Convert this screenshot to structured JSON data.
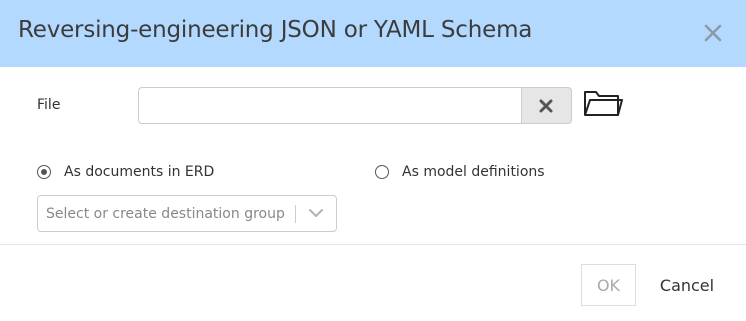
{
  "dialog": {
    "title": "Reversing-engineering JSON or YAML Schema",
    "close_icon": "close-icon"
  },
  "file": {
    "label": "File",
    "value": "",
    "clear_icon": "clear-x-icon",
    "browse_icon": "folder-icon"
  },
  "import_mode": {
    "options": [
      {
        "label": "As documents in ERD",
        "selected": true
      },
      {
        "label": "As model definitions",
        "selected": false
      }
    ]
  },
  "destination_group": {
    "placeholder": "Select or create destination group",
    "value": "",
    "arrow_icon": "chevron-down-icon"
  },
  "footer": {
    "ok_label": "OK",
    "ok_enabled": false,
    "cancel_label": "Cancel"
  },
  "colors": {
    "header_bg": "#b3d9ff",
    "disabled_text": "#aaaaaa"
  }
}
